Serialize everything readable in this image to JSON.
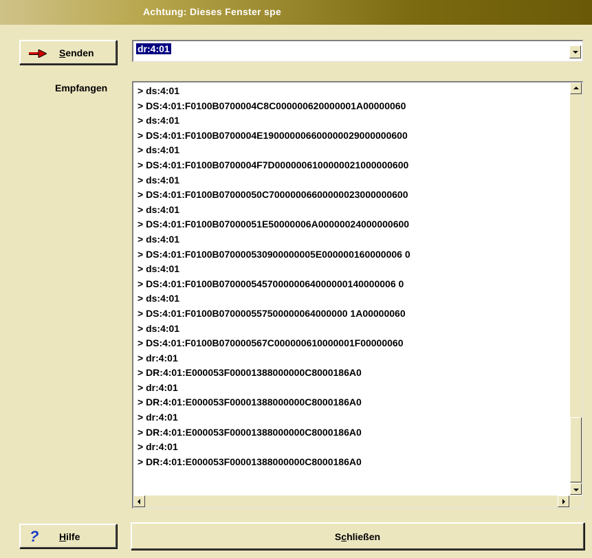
{
  "window": {
    "title": "Achtung: Dieses Fenster spe"
  },
  "toolbar": {
    "send_label": "Senden",
    "send_mnemonic": "S",
    "send_rest": "enden",
    "send_icon": "red-arrow-right-icon"
  },
  "command": {
    "value": "dr:4:01",
    "dropdown_icon": "chevron-down-icon"
  },
  "receive": {
    "label": "Empfangen",
    "lines": [
      "> ds:4:01",
      "> DS:4:01:F0100B0700004C8C000000620000001A00000060",
      "> ds:4:01",
      "> DS:4:01:F0100B0700004E190000006600000029000000600",
      "> ds:4:01",
      "> DS:4:01:F0100B0700004F7D0000006100000021000000600",
      "> ds:4:01",
      "> DS:4:01:F0100B07000050C70000006600000023000000600",
      "> ds:4:01",
      "> DS:4:01:F0100B07000051E50000006A00000024000000600",
      "> ds:4:01",
      "> DS:4:01:F0100B070000530900000005E000000160000006 0",
      "> ds:4:01",
      "> DS:4:01:F0100B070000545700000064000000140000006 0",
      "> ds:4:01",
      "> DS:4:01:F0100B070000557500000064000000 1A00000060",
      "> ds:4:01",
      "> DS:4:01:F0100B070000567C000000610000001F00000060",
      "> dr:4:01",
      "> DR:4:01:E000053F00001388000000C8000186A0",
      "> dr:4:01",
      "> DR:4:01:E000053F00001388000000C8000186A0",
      "> dr:4:01",
      "> DR:4:01:E000053F00001388000000C8000186A0",
      "> dr:4:01",
      "> DR:4:01:E000053F00001388000000C8000186A0"
    ]
  },
  "footer": {
    "help_label": "Hilfe",
    "help_mnemonic": "H",
    "help_rest": "ilfe",
    "help_icon": "question-mark-icon",
    "close_label": "Schließen",
    "close_pre": "S",
    "close_mnemonic": "c",
    "close_rest": "hließen"
  },
  "colors": {
    "panel": "#ece6bf",
    "title_dark": "#6a5a08",
    "selection": "#000080",
    "arrow": "#d00000",
    "help_icon": "#1a3cc8"
  }
}
